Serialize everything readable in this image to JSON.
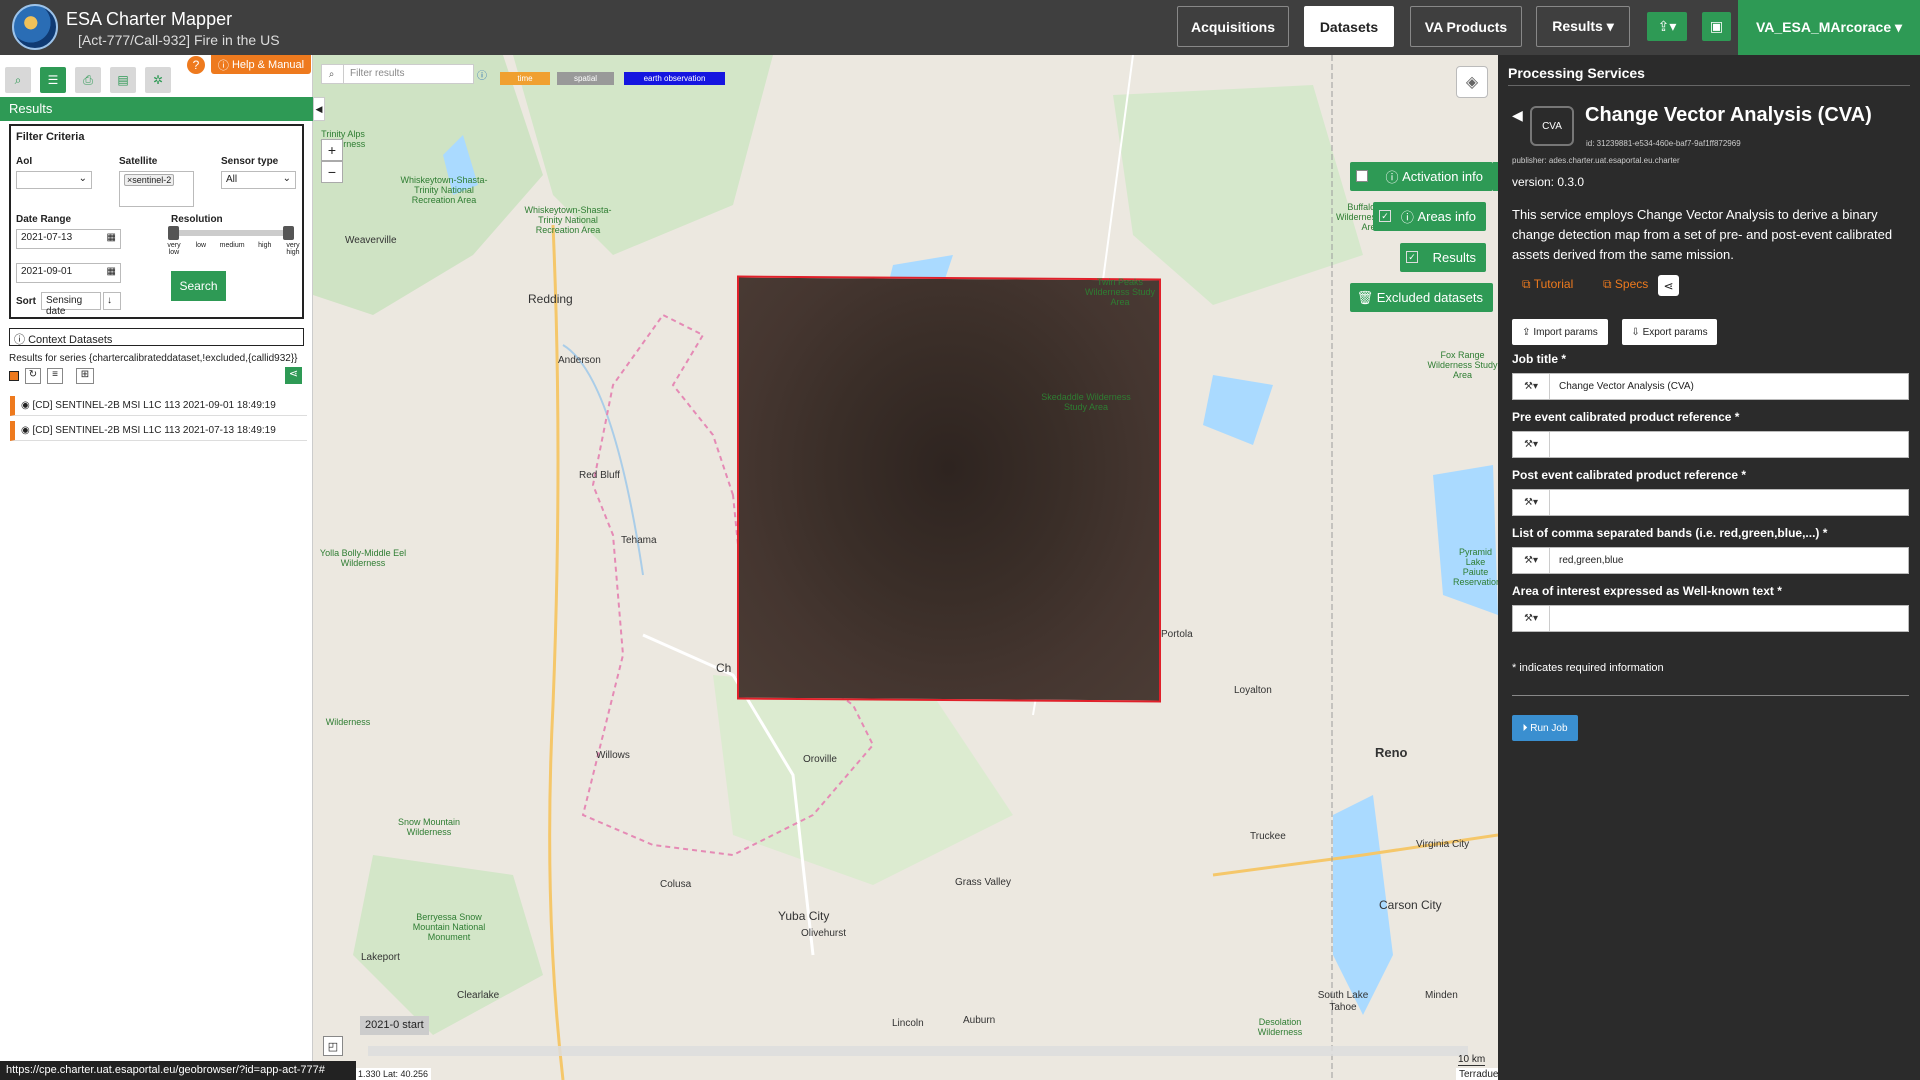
{
  "header": {
    "app_title": "ESA Charter Mapper",
    "subtitle": "[Act-777/Call-932] Fire in the US",
    "nav": [
      "Acquisitions",
      "Datasets",
      "VA Products",
      "Results ▾"
    ],
    "user": "VA_ESA_MArcorace ▾"
  },
  "left": {
    "help_label": "Help & Manual",
    "results_title": "Results",
    "filter": {
      "title": "Filter Criteria",
      "aoi_label": "AoI",
      "satellite_label": "Satellite",
      "satellite_chip": "×sentinel-2",
      "sensor_label": "Sensor type",
      "sensor_value": "All",
      "date_label": "Date Range",
      "date_from": "2021-07-13",
      "date_to": "2021-09-01",
      "resolution_label": "Resolution",
      "res_ticks": [
        "very low",
        "low",
        "medium",
        "high",
        "very high"
      ],
      "sort_label": "Sort",
      "sort_value": "Sensing date",
      "search_label": "Search"
    },
    "context_title": "Context Datasets",
    "series_text": "Results for series {chartercalibrateddataset,!excluded,{callid932}}",
    "items": [
      "[CD] SENTINEL-2B MSI L1C 113 2021-09-01 18:49:19",
      "[CD] SENTINEL-2B MSI L1C 113 2021-07-13 18:49:19"
    ]
  },
  "map": {
    "filter_placeholder": "Filter results",
    "tags": [
      "time",
      "spatial",
      "earth observation"
    ],
    "buttons": [
      "Activation info",
      "Areas info",
      "Results",
      "Excluded datasets"
    ],
    "places": [
      "Redding",
      "Anderson",
      "Red Bluff",
      "Tehama",
      "Willows",
      "Oroville",
      "Yuba City",
      "Colusa",
      "Grass Valley",
      "Portola",
      "Loyalton",
      "Reno",
      "Truckee",
      "Carson City",
      "Virginia City",
      "South Lake Tahoe",
      "Auburn",
      "Lincoln",
      "Olivehurst",
      "Minden",
      "Lakeport",
      "Clearlake",
      "Weaverville",
      "Ch"
    ],
    "green_places": [
      "Whiskeytown-Shasta-Trinity National Recreation Area",
      "Whiskeytown-Shasta-Trinity National Recreation Area",
      "Yolla Bolly-Middle Eel Wilderness",
      "Snow Mountain Wilderness",
      "Berryessa Snow Mountain National Monument",
      "Skedaddle Wilderness Study Area",
      "Twin Peaks Wilderness Study Area",
      "Buffalo Hills Wilderness Study Area",
      "Fox Range Wilderness Study Area",
      "Desolation Wilderness",
      "Wilderness",
      "Trinity Alps Wilderness",
      "Pyramid Lake Paiute Reservation"
    ],
    "timeline_label": "2021-0 start",
    "scale": "10 km",
    "attribution": "Terradue",
    "coords": "1.330 Lat: 40.256"
  },
  "panel": {
    "section_title": "Processing Services",
    "badge": "CVA",
    "title": "Change Vector Analysis (CVA)",
    "id": "id: 31239881-e534-460e-baf7-9af1ff872969",
    "publisher": "publisher: ades.charter.uat.esaportal.eu.charter",
    "version": "version: 0.3.0",
    "description": "This service employs Change Vector Analysis to derive a binary change detection map from a set of pre- and post-event calibrated assets derived from the same mission.",
    "tutorial": "Tutorial",
    "specs": "Specs",
    "import": "Import params",
    "export": "Export params",
    "fields": [
      {
        "label": "Job title *",
        "value": "Change Vector Analysis (CVA)"
      },
      {
        "label": "Pre event calibrated product reference *",
        "value": ""
      },
      {
        "label": "Post event calibrated product reference *",
        "value": ""
      },
      {
        "label": "List of comma separated bands (i.e. red,green,blue,...) *",
        "value": "red,green,blue"
      },
      {
        "label": "Area of interest expressed as Well-known text *",
        "value": ""
      }
    ],
    "required_note": "* indicates required information",
    "run": "Run Job"
  },
  "status_url": "https://cpe.charter.uat.esaportal.eu/geobrowser/?id=app-act-777#"
}
